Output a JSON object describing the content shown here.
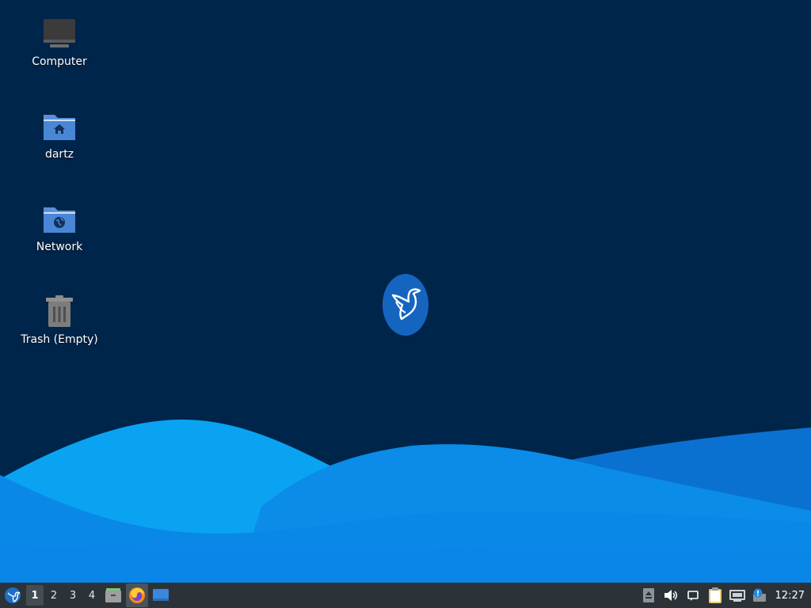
{
  "desktop": {
    "icons": [
      {
        "label": "Computer",
        "icon": "computer-icon"
      },
      {
        "label": "dartz",
        "icon": "home-folder-icon"
      },
      {
        "label": "Network",
        "icon": "network-folder-icon"
      },
      {
        "label": "Trash (Empty)",
        "icon": "trash-icon"
      }
    ],
    "center_logo": "bird-logo-icon"
  },
  "taskbar": {
    "menu_icon": "whisker-menu-icon",
    "workspaces": [
      {
        "label": "1",
        "active": true
      },
      {
        "label": "2",
        "active": false
      },
      {
        "label": "3",
        "active": false
      },
      {
        "label": "4",
        "active": false
      }
    ],
    "launchers": [
      {
        "icon": "file-manager-icon",
        "active": false
      },
      {
        "icon": "firefox-icon",
        "active": true
      },
      {
        "icon": "show-desktop-icon",
        "active": false
      }
    ],
    "tray": [
      "eject-icon",
      "volume-icon",
      "notification-icon",
      "clipboard-icon",
      "network-wired-icon",
      "update-icon"
    ],
    "clock": "12:27"
  },
  "colors": {
    "background": "#00254a",
    "wave_light": "#0aa0f0",
    "wave_mid": "#0a86e6",
    "taskbar": "#2b3338",
    "accent": "#1565c0"
  }
}
